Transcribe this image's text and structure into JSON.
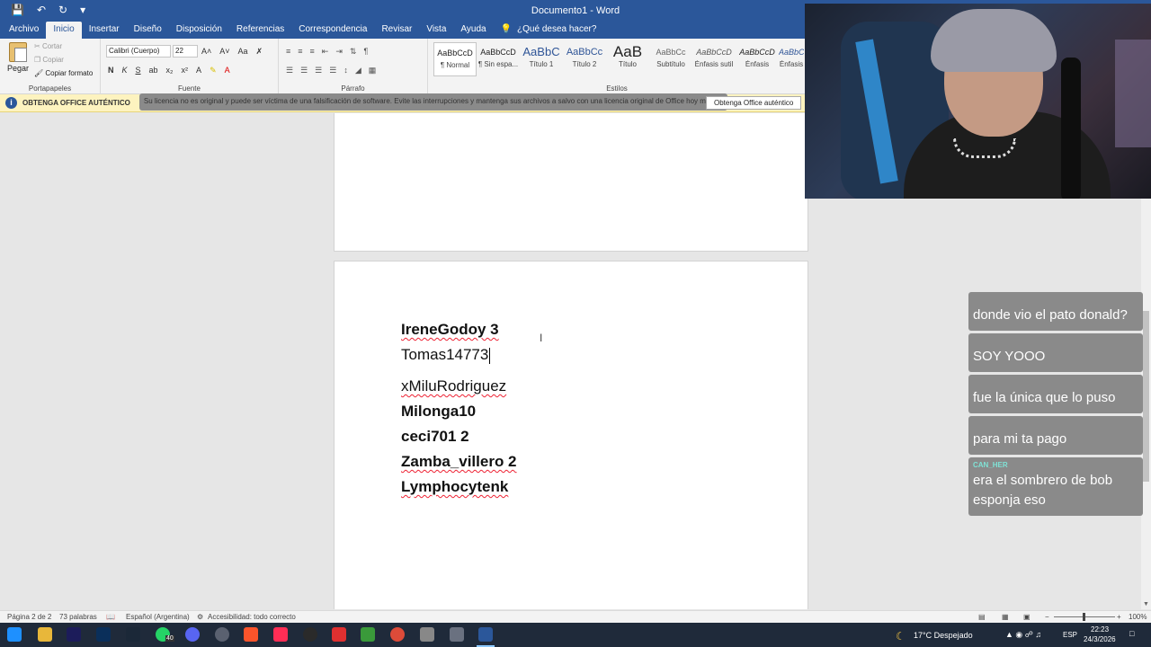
{
  "window": {
    "title": "Documento1  -  Word"
  },
  "quick_access": {
    "save_icon": "save-icon",
    "undo_icon": "undo-icon",
    "redo_icon": "redo-icon"
  },
  "tabs": [
    "Archivo",
    "Inicio",
    "Insertar",
    "Diseño",
    "Disposición",
    "Referencias",
    "Correspondencia",
    "Revisar",
    "Vista",
    "Ayuda"
  ],
  "active_tab": "Inicio",
  "tell_me": "¿Qué desea hacer?",
  "ribbon": {
    "clipboard": {
      "paste": "Pegar",
      "cut": "Cortar",
      "copy": "Copiar",
      "format_painter": "Copiar formato",
      "label": "Portapapeles"
    },
    "font": {
      "name": "Calibri (Cuerpo)",
      "size": "22",
      "label": "Fuente",
      "bold": "N",
      "italic": "K",
      "underline": "S"
    },
    "paragraph": {
      "label": "Párrafo"
    },
    "styles": {
      "label": "Estilos",
      "items": [
        {
          "sample": "AaBbCcD",
          "name": "¶ Normal"
        },
        {
          "sample": "AaBbCcD",
          "name": "¶ Sin espa..."
        },
        {
          "sample": "AaBbC",
          "name": "Título 1"
        },
        {
          "sample": "AaBbCc",
          "name": "Título 2"
        },
        {
          "sample": "AaB",
          "name": "Título"
        },
        {
          "sample": "AaBbCc",
          "name": "Subtítulo"
        },
        {
          "sample": "AaBbCcD",
          "name": "Énfasis sutil"
        },
        {
          "sample": "AaBbCcD",
          "name": "Énfasis"
        },
        {
          "sample": "AaBbCc",
          "name": "Énfasis"
        }
      ]
    }
  },
  "infobar": {
    "heading": "OBTENGA OFFICE AUTÉNTICO",
    "message": "Su licencia no es original y puede ser víctima de una falsificación de software. Evite las interrupciones y mantenga sus archivos a salvo con una licencia original de Office hoy mismo.",
    "button": "Obtenga Office auténtico"
  },
  "document": {
    "lines": [
      {
        "text": "IreneGodoy 3",
        "bold": true
      },
      {
        "text": "Tomas14773",
        "bold": false
      },
      {
        "text": "xMiluRodriguez",
        "bold": false
      },
      {
        "text": "Milonga10",
        "bold": true
      },
      {
        "text": "ceci701 2",
        "bold": true
      },
      {
        "text": "Zamba_villero 2",
        "bold": true
      },
      {
        "text": "Lymphocytenk",
        "bold": true
      }
    ]
  },
  "chat": [
    {
      "user": "",
      "user_color": "#e08a1e",
      "text": "donde vio el pato donald?"
    },
    {
      "user": "",
      "user_color": "#e0801e",
      "text": "SOY YOOO"
    },
    {
      "user": "",
      "user_color": "#d83060",
      "text": "fue la única que lo puso"
    },
    {
      "user": "",
      "user_color": "#e0801e",
      "text": "para mi ta pago"
    },
    {
      "user": "CAN_HER",
      "user_color": "#7fe3d6",
      "text": "era el sombrero de bob esponja eso"
    }
  ],
  "statusbar": {
    "page": "Página 2 de 2",
    "words": "73 palabras",
    "language": "Español (Argentina)",
    "accessibility": "Accesibilidad: todo correcto",
    "zoom": "100%"
  },
  "taskbar": {
    "weather": "17°C  Despejado",
    "lang": "ESP",
    "time": "22:23",
    "date": "24/3/2026",
    "badge": "40"
  }
}
